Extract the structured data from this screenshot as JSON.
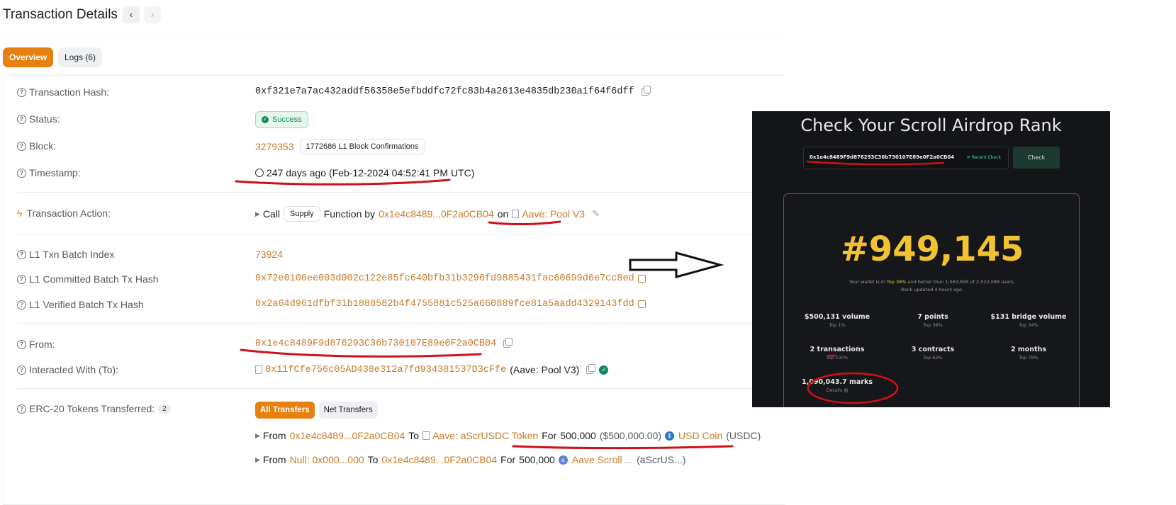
{
  "header": {
    "title": "Transaction Details",
    "prev_glyph": "‹",
    "next_glyph": "›"
  },
  "tabs": [
    {
      "label": "Overview",
      "active": true
    },
    {
      "label": "Logs (6)",
      "active": false
    }
  ],
  "details": {
    "tx_hash": {
      "label": "Transaction Hash:",
      "value": "0xf321e7a7ac432addf56358e5efbddfc72fc83b4a2613e4835db230a1f64f6dff"
    },
    "status": {
      "label": "Status:",
      "value": "Success"
    },
    "block": {
      "label": "Block:",
      "value": "3279353",
      "confirmations": "1772686 L1 Block Confirmations"
    },
    "timestamp": {
      "label": "Timestamp:",
      "value": "247 days ago (Feb-12-2024 04:52:41 PM UTC)"
    },
    "action": {
      "label": "Transaction Action:",
      "call": "Call",
      "method": "Supply",
      "function_by": "Function by",
      "from_addr": "0x1e4c8489...0F2a0CB04",
      "on": "on",
      "contract": "Aave: Pool V3"
    },
    "l1_batch_index": {
      "label": "L1 Txn Batch Index",
      "value": "73924"
    },
    "l1_committed": {
      "label": "L1 Committed Batch Tx Hash",
      "value": "0x72e0100ee003d002c122e85fc640bfb31b3296fd9885431fac60699d6e7cc8ed"
    },
    "l1_verified": {
      "label": "L1 Verified Batch Tx Hash",
      "value": "0x2a64d961dfbf31b1880582b4f4755881c525a660889fce81a5aadd4329143fdd"
    },
    "from": {
      "label": "From:",
      "value": "0x1e4c8489F9d876293C36b730107E89e0F2a0CB04"
    },
    "to": {
      "label": "Interacted With (To):",
      "value": "0x11fCfe756c05AD438e312a7fd934381537D3cFfe",
      "name": "(Aave: Pool V3)"
    },
    "erc20": {
      "label": "ERC-20 Tokens Transferred:",
      "count": "2",
      "all_btn": "All Transfers",
      "net_btn": "Net Transfers",
      "transfers": [
        {
          "from_word": "From",
          "from": "0x1e4c8489...0F2a0CB04",
          "to_word": "To",
          "to": "Aave: aScrUSDC Token",
          "for_word": "For",
          "amount": "500,000",
          "usd": "($500,000.00)",
          "token": "USD Coin",
          "symbol": "(USDC)"
        },
        {
          "from_word": "From",
          "from": "Null: 0x000...000",
          "to_word": "To",
          "to": "0x1e4c8489...0F2a0CB04",
          "for_word": "For",
          "amount": "500,000",
          "usd": "",
          "token": "Aave Scroll ...",
          "symbol": "(aScrUS...)"
        }
      ]
    }
  },
  "airdrop": {
    "title": "Check Your Scroll Airdrop Rank",
    "address": "0x1e4c8489F9d876293C36b730107E89e0F2a0CB04",
    "recent_check": "Recent Check",
    "check_button": "Check",
    "rank": "#949,145",
    "wallet_pre": "Your wallet is in",
    "wallet_top": "Top 38%",
    "wallet_post": "and better than 1,563,695 of 2,522,089 users.",
    "updated": "Rank updated 4 hours ago.",
    "stats": [
      {
        "value": "$500,131 volume",
        "top": "Top 1%"
      },
      {
        "value": "7 points",
        "top": "Top 38%"
      },
      {
        "value": "$131 bridge volume",
        "top": "Top 34%"
      },
      {
        "value": "2 transactions",
        "top": "Top 100%"
      },
      {
        "value": "3 contracts",
        "top": "Top 62%"
      },
      {
        "value": "2 months",
        "top": "Top 78%"
      }
    ],
    "marks": {
      "value": "1,090,043.7 marks",
      "details": "Details"
    },
    "colors": {
      "bg": "#141518",
      "gold": "#f3c230",
      "green": "#56d3a6"
    }
  },
  "colors": {
    "accent": "#e8800f",
    "link": "#c77c2c",
    "success": "#0f8a5f",
    "annotation_red": "#d0101a"
  }
}
